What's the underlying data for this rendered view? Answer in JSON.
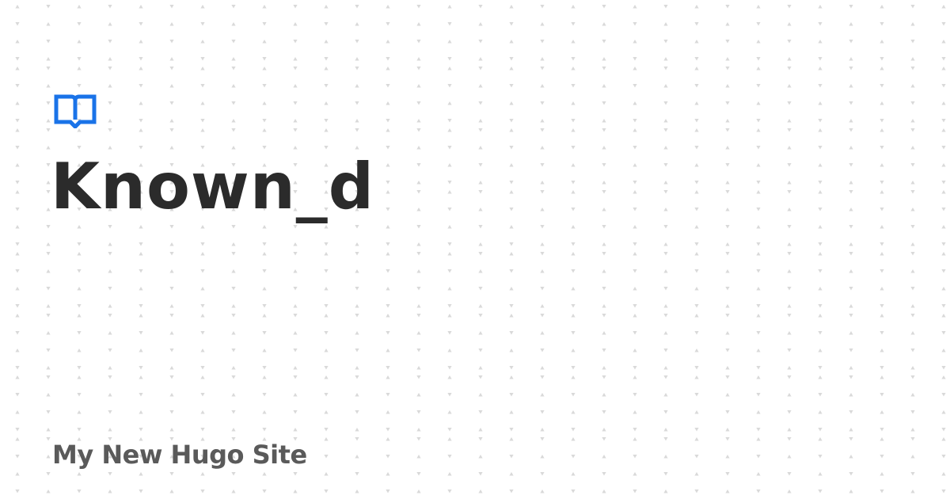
{
  "card": {
    "title": "Known_d",
    "site_name": "My New Hugo Site",
    "logo_icon": "book-open-icon",
    "colors": {
      "accent": "#1a73e8",
      "title": "#2b2b2b",
      "site_name": "#5a5a5a",
      "pattern": "#d9d9d9",
      "background": "#ffffff"
    }
  }
}
